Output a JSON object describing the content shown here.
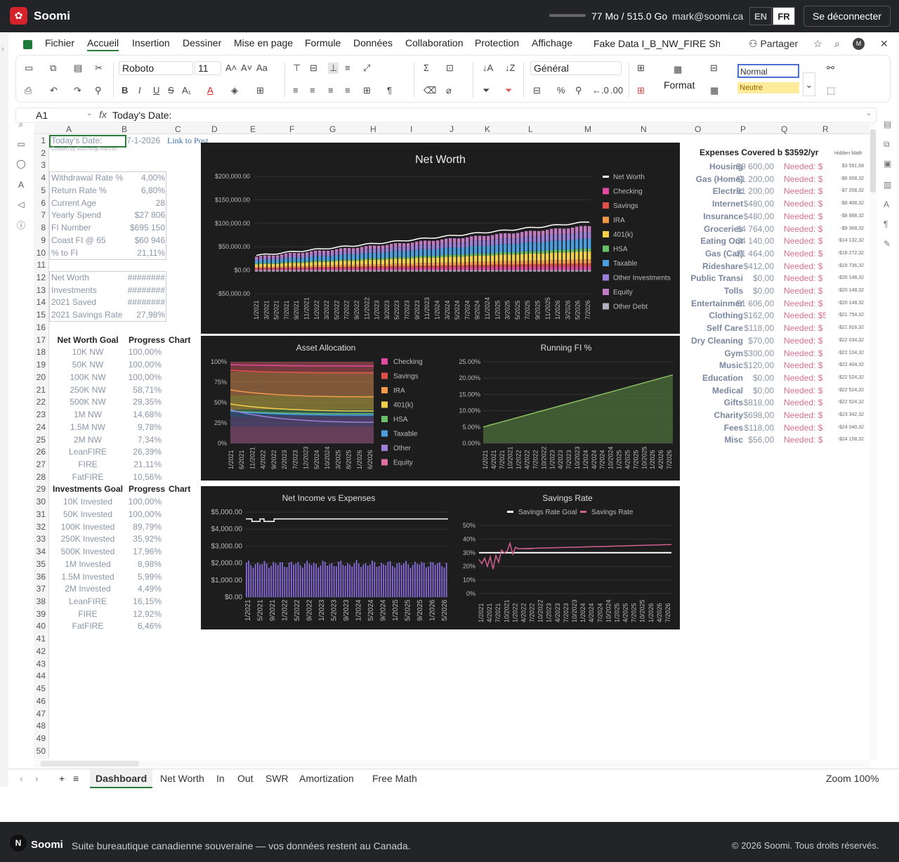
{
  "topbar": {
    "brand": "Soomi",
    "storage": "77 Mo / 515.0 Go",
    "email": "mark@soomi.ca",
    "lang_en": "EN",
    "lang_fr": "FR",
    "logout": "Se déconnecter"
  },
  "menu": [
    "Fichier",
    "Accueil",
    "Insertion",
    "Dessiner",
    "Mise en page",
    "Formule",
    "Données",
    "Collaboration",
    "Protection",
    "Affichage"
  ],
  "docname": "Fake Data I_B_NW_FIRE She",
  "share": "Partager",
  "ribbon": {
    "font": "Roboto",
    "size": "11",
    "numfmt": "Général",
    "format": "Format",
    "style_normal": "Normal",
    "style_neutral": "Neutre"
  },
  "formula": {
    "cellref": "A1",
    "fx": "fx",
    "value": "Today's Date:"
  },
  "columns": [
    "A",
    "B",
    "C",
    "D",
    "E",
    "F",
    "G",
    "H",
    "I",
    "J",
    "K",
    "L",
    "M",
    "N",
    "O",
    "P",
    "Q",
    "R"
  ],
  "cells": {
    "a1": "Today's Date:",
    "a1sub": "Created by BloomingFinances",
    "b1": "7-1-2026",
    "c1": "Link to Post",
    "params": [
      [
        "Withdrawal Rate %",
        "4,00%"
      ],
      [
        "Return Rate %",
        "6,80%"
      ],
      [
        "Current Age",
        "28"
      ],
      [
        "Yearly Spend",
        "$27 806"
      ],
      [
        "FI Number",
        "$695 150"
      ],
      [
        "Coast FI @ 65",
        "$60 946"
      ],
      [
        "% to FI",
        "21,11%"
      ]
    ],
    "nw": [
      [
        "Net Worth",
        "########"
      ],
      [
        "Investments",
        "########"
      ],
      [
        "2021 Saved",
        "########"
      ],
      [
        "2021 Savings Rate",
        "27,98%"
      ]
    ],
    "nwgoal_h": [
      "Net Worth Goal",
      "Progress",
      "Chart"
    ],
    "nwgoals": [
      [
        "10K NW",
        "100,00%"
      ],
      [
        "50K NW",
        "100,00%"
      ],
      [
        "100K NW",
        "100,00%"
      ],
      [
        "250K NW",
        "58,71%"
      ],
      [
        "500K NW",
        "29,35%"
      ],
      [
        "1M NW",
        "14,68%"
      ],
      [
        "1.5M NW",
        "9,78%"
      ],
      [
        "2M NW",
        "7,34%"
      ],
      [
        "LeanFIRE",
        "26,39%"
      ],
      [
        "FIRE",
        "21,11%"
      ],
      [
        "FatFIRE",
        "10,56%"
      ]
    ],
    "invgoal_h": [
      "Investments Goal",
      "Progress",
      "Chart"
    ],
    "invgoals": [
      [
        "10K Invested",
        "100,00%"
      ],
      [
        "50K Invested",
        "100,00%"
      ],
      [
        "100K Invested",
        "89,79%"
      ],
      [
        "250K Invested",
        "35,92%"
      ],
      [
        "500K Invested",
        "17,96%"
      ],
      [
        "1M Invested",
        "8,98%"
      ],
      [
        "1.5M Invested",
        "5,99%"
      ],
      [
        "2M Invested",
        "4,49%"
      ],
      [
        "LeanFIRE",
        "16,15%"
      ],
      [
        "FIRE",
        "12,92%"
      ],
      [
        "FatFIRE",
        "6,46%"
      ]
    ]
  },
  "expenses": {
    "title": "Expenses Covered b $3592/yr",
    "hidden": "Hidden Math",
    "rows": [
      [
        "Housing",
        "$9 600,00",
        "Needed: $",
        "$3 591,68"
      ],
      [
        "Gas (Home)",
        "$1 200,00",
        "Needed: $",
        "-$6 008,32"
      ],
      [
        "Electric",
        "$1 200,00",
        "Needed: $",
        "-$7 208,32"
      ],
      [
        "Internet",
        "$480,00",
        "Needed: $",
        "-$8 408,32"
      ],
      [
        "Insurance",
        "$480,00",
        "Needed: $",
        "-$8 888,32"
      ],
      [
        "Groceries",
        "$4 764,00",
        "Needed: $",
        "-$9 368,32"
      ],
      [
        "Eating Out",
        "$4 140,00",
        "Needed: $",
        "-$14 132,32"
      ],
      [
        "Gas (Car)",
        "$1 464,00",
        "Needed: $",
        "-$18 272,32"
      ],
      [
        "Rideshare",
        "$412,00",
        "Needed: $",
        "-$19 736,32"
      ],
      [
        "Public Transi",
        "$0,00",
        "Needed: $",
        "-$20 148,32"
      ],
      [
        "Tolls",
        "$0,00",
        "Needed: $",
        "-$20 148,32"
      ],
      [
        "Entertainmer",
        "$1 606,00",
        "Needed: $",
        "-$20 148,32"
      ],
      [
        "Clothing",
        "$162,00",
        "Needed: $5",
        "-$21 754,32"
      ],
      [
        "Self Care",
        "$118,00",
        "Needed: $",
        "-$21 916,32"
      ],
      [
        "Dry Cleaning",
        "$70,00",
        "Needed: $",
        "-$22 034,32"
      ],
      [
        "Gym",
        "$300,00",
        "Needed: $",
        "-$22 104,32"
      ],
      [
        "Music",
        "$120,00",
        "Needed: $",
        "-$22 404,32"
      ],
      [
        "Education",
        "$0,00",
        "Needed: $",
        "-$22 524,32"
      ],
      [
        "Medical",
        "$0,00",
        "Needed: $",
        "-$22 524,32"
      ],
      [
        "Gifts",
        "$818,00",
        "Needed: $",
        "-$22 524,32"
      ],
      [
        "Charity",
        "$698,00",
        "Needed: $",
        "-$23 342,32"
      ],
      [
        "Fees",
        "$118,00",
        "Needed: $",
        "-$24 040,32"
      ],
      [
        "Misc",
        "$56,00",
        "Needed: $",
        "-$24 158,32"
      ]
    ]
  },
  "tabs": [
    "Dashboard",
    "Net Worth",
    "In",
    "Out",
    "SWR",
    "Amortization",
    "Free Math"
  ],
  "zoom": "Zoom 100%",
  "footer": {
    "brand": "Soomi",
    "tagline": "Suite bureautique canadienne souveraine — vos données restent au Canada.",
    "copyright": "© 2026 Soomi. Tous droits réservés."
  },
  "chart_data": [
    {
      "type": "bar",
      "title": "Net Worth",
      "ylim": [
        -50000,
        200000
      ],
      "yticks": [
        "$200,000.00",
        "$150,000.00",
        "$100,000.00",
        "$50,000.00",
        "$0.00",
        "-$50,000.00"
      ],
      "xticks": [
        "1/2021",
        "3/2021",
        "5/2021",
        "7/2021",
        "9/2021",
        "11/2021",
        "1/2022",
        "3/2022",
        "5/2022",
        "7/2022",
        "9/2022",
        "11/2022",
        "1/2023",
        "3/2023",
        "5/2023",
        "7/2023",
        "9/2023",
        "11/2023",
        "1/2024",
        "3/2024",
        "5/2024",
        "7/2024",
        "9/2024",
        "11/2024",
        "1/2025",
        "3/2025",
        "5/2025",
        "7/2025",
        "9/2025",
        "11/2025",
        "1/2026",
        "3/2026",
        "5/2026",
        "7/2026"
      ],
      "series": [
        {
          "name": "Net Worth",
          "color": "#ffffff"
        },
        {
          "name": "Checking",
          "color": "#e04aa0"
        },
        {
          "name": "Savings",
          "color": "#e0504a"
        },
        {
          "name": "IRA",
          "color": "#f2994a"
        },
        {
          "name": "401(k)",
          "color": "#f2d04a"
        },
        {
          "name": "HSA",
          "color": "#6abf69"
        },
        {
          "name": "Taxable",
          "color": "#4a9ee0"
        },
        {
          "name": "Other Investments",
          "color": "#9b7fd6"
        },
        {
          "name": "Equity",
          "color": "#c07ac0"
        },
        {
          "name": "Other Debt",
          "color": "#b0b0c0"
        }
      ],
      "start_total": 32000,
      "end_total": 105000
    },
    {
      "type": "area",
      "title": "Asset Allocation",
      "yticks": [
        "100%",
        "75%",
        "50%",
        "25%",
        "0%"
      ],
      "xticks": [
        "1/2021",
        "6/2021",
        "11/2021",
        "4/2022",
        "9/2022",
        "2/2023",
        "7/2023",
        "12/2023",
        "5/2024",
        "10/2024",
        "3/2025",
        "8/2025",
        "1/2026",
        "6/2026"
      ],
      "series": [
        {
          "name": "Checking",
          "color": "#e04aa0"
        },
        {
          "name": "Savings",
          "color": "#e0504a"
        },
        {
          "name": "IRA",
          "color": "#f2994a"
        },
        {
          "name": "401(k)",
          "color": "#f2d04a"
        },
        {
          "name": "HSA",
          "color": "#6abf69"
        },
        {
          "name": "Taxable",
          "color": "#4a9ee0"
        },
        {
          "name": "Other",
          "color": "#9b7fd6"
        },
        {
          "name": "Equity",
          "color": "#e070a0"
        }
      ]
    },
    {
      "type": "area",
      "title": "Running FI %",
      "yticks": [
        "25.00%",
        "20.00%",
        "15.00%",
        "10.00%",
        "5.00%",
        "0.00%"
      ],
      "ylim": [
        0,
        25
      ],
      "start": 5,
      "end": 21,
      "xticks": [
        "1/2021",
        "4/2021",
        "7/2021",
        "10/2021",
        "1/2022",
        "4/2022",
        "7/2022",
        "10/2022",
        "1/2023",
        "4/2023",
        "7/2023",
        "10/2023",
        "1/2024",
        "4/2024",
        "7/2024",
        "10/2024",
        "1/2025",
        "4/2025",
        "7/2025",
        "10/2025",
        "1/2026",
        "4/2026",
        "7/2026"
      ]
    },
    {
      "type": "bar",
      "title": "Net Income vs Expenses",
      "yticks": [
        "$5,000.00",
        "$4,000.00",
        "$3,000.00",
        "$2,000.00",
        "$1,000.00",
        "$0.00"
      ],
      "ylim": [
        0,
        5000
      ],
      "xticks": [
        "1/2021",
        "5/2021",
        "9/2021",
        "1/2022",
        "5/2022",
        "9/2022",
        "1/2023",
        "5/2023",
        "9/2023",
        "1/2024",
        "5/2024",
        "9/2024",
        "1/2025",
        "5/2025",
        "9/2025",
        "1/2026",
        "5/2026"
      ],
      "series": [
        {
          "name": "Net Income",
          "color": "#ffffff"
        },
        {
          "name": "Expenses",
          "color": "#8a6fe0"
        }
      ]
    },
    {
      "type": "line",
      "title": "Savings Rate",
      "yticks": [
        "50%",
        "40%",
        "30%",
        "20%",
        "10%",
        "0%"
      ],
      "ylim": [
        0,
        50
      ],
      "xticks": [
        "1/2021",
        "4/2021",
        "7/2021",
        "10/2021",
        "1/2022",
        "4/2022",
        "7/2022",
        "10/2022",
        "1/2023",
        "4/2023",
        "7/2023",
        "10/2023",
        "1/2024",
        "4/2024",
        "7/2024",
        "10/2024",
        "1/2025",
        "4/2025",
        "7/2025",
        "10/2025",
        "1/2026",
        "4/2026",
        "7/2026"
      ],
      "series": [
        {
          "name": "Savings Rate Goal",
          "color": "#ffffff",
          "value": 30
        },
        {
          "name": "Savings Rate",
          "color": "#d06090"
        }
      ]
    }
  ]
}
